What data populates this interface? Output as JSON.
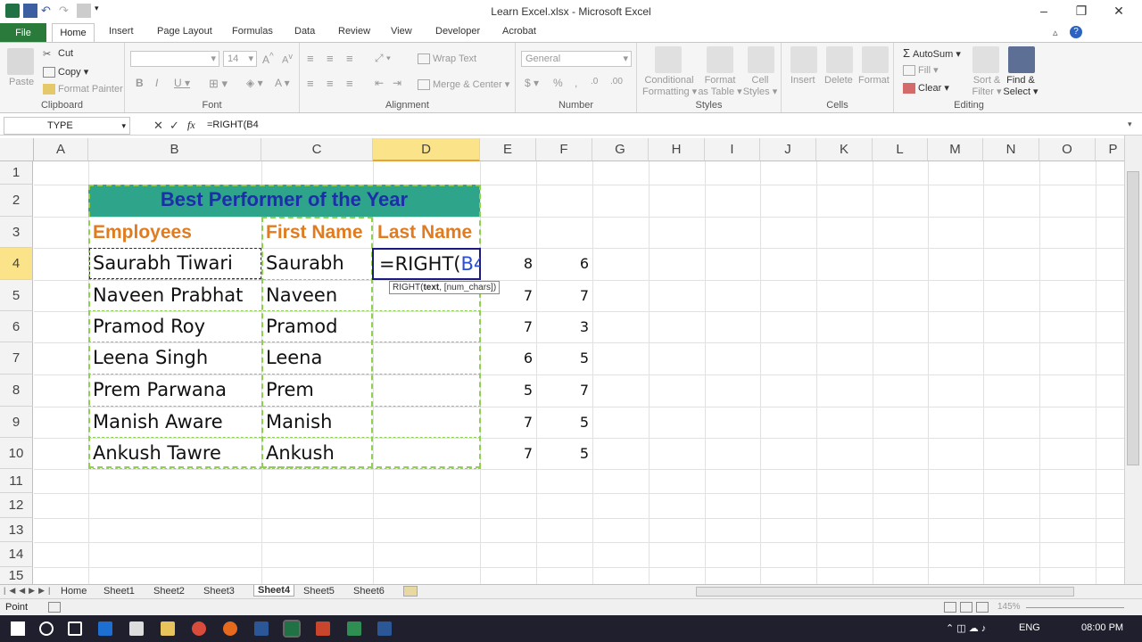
{
  "window": {
    "title": "Learn Excel.xlsx - Microsoft Excel"
  },
  "tabs": [
    "File",
    "Home",
    "Insert",
    "Page Layout",
    "Formulas",
    "Data",
    "Review",
    "View",
    "Developer",
    "Acrobat"
  ],
  "ribbon": {
    "clipboard": {
      "paste": "Paste",
      "cut": "Cut",
      "copy": "Copy",
      "format_painter": "Format Painter",
      "label": "Clipboard"
    },
    "font": {
      "size": "14",
      "label": "Font"
    },
    "alignment": {
      "wrap": "Wrap Text",
      "merge": "Merge & Center",
      "label": "Alignment"
    },
    "number": {
      "format": "General",
      "label": "Number"
    },
    "styles": {
      "cond1": "Conditional",
      "cond2": "Formatting",
      "fmt1": "Format",
      "fmt2": "as Table",
      "cell1": "Cell",
      "cell2": "Styles",
      "label": "Styles"
    },
    "cells": {
      "insert": "Insert",
      "delete": "Delete",
      "format": "Format",
      "label": "Cells"
    },
    "editing": {
      "autosum": "AutoSum",
      "fill": "Fill",
      "clear": "Clear",
      "sort1": "Sort &",
      "sort2": "Filter",
      "find1": "Find &",
      "find2": "Select",
      "label": "Editing"
    }
  },
  "formula_bar": {
    "name_box": "TYPE",
    "fx": "fx",
    "formula": "=RIGHT(B4"
  },
  "columns": [
    "A",
    "B",
    "C",
    "D",
    "E",
    "F",
    "G",
    "H",
    "I",
    "J",
    "K",
    "L",
    "M",
    "N",
    "O",
    "P"
  ],
  "rows": [
    "1",
    "2",
    "3",
    "4",
    "5",
    "6",
    "7",
    "8",
    "9",
    "10",
    "11",
    "12",
    "13",
    "14",
    "15"
  ],
  "table": {
    "banner": "Best Performer of the Year",
    "headers": [
      "Employees",
      "First Name",
      "Last Name"
    ],
    "employees": [
      "Saurabh Tiwari",
      "Naveen Prabhat",
      "Pramod Roy",
      "Leena Singh",
      "Prem Parwana",
      "Manish Aware",
      "Ankush Tawre"
    ],
    "first_names": [
      "Saurabh",
      "Naveen",
      "Pramod",
      "Leena",
      "Prem",
      "Manish",
      "Ankush"
    ],
    "active_formula_prefix": "=RIGHT(",
    "active_formula_ref": "B4",
    "col_e": [
      "8",
      "7",
      "7",
      "6",
      "5",
      "7",
      "7"
    ],
    "col_f": [
      "6",
      "7",
      "3",
      "5",
      "7",
      "5",
      "5"
    ]
  },
  "tooltip": {
    "fn": "RIGHT(",
    "arg1": "text",
    "rest": ", [num_chars])"
  },
  "sheets": [
    "Home",
    "Sheet1",
    "Sheet2",
    "Sheet3",
    "Sheet4",
    "Sheet5",
    "Sheet6"
  ],
  "active_sheet": "Sheet4",
  "status": {
    "mode": "Point",
    "zoom": "145%"
  },
  "taskbar": {
    "lang": "ENG",
    "time": "08:00 PM"
  },
  "colors": {
    "accent": "#2a7a3b",
    "banner": "#2ea58a",
    "banner_text": "#1c2ea8",
    "header_text": "#e07b20",
    "border": "#8fd14f"
  }
}
